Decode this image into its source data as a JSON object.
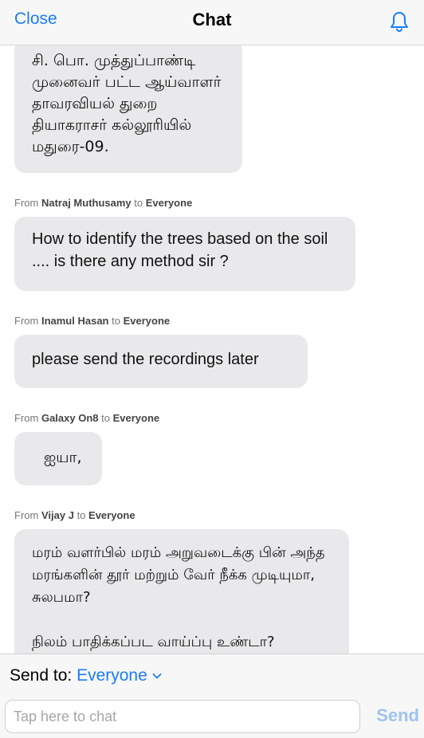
{
  "header": {
    "close_label": "Close",
    "title": "Chat",
    "bell_icon": "bell-icon"
  },
  "messages": [
    {
      "from": "",
      "to": "",
      "text": "சி. பொ. முத்துப்பாண்டி\nமுனைவர் பட்ட ஆய்வாளர்\nதாவரவியல் துறை\nதியாகராசர் கல்லூரியில்\nமதுரை-09."
    },
    {
      "from": "Natraj Muthusamy",
      "to": "Everyone",
      "text": "How to identify the trees based on the soil .... is there any method sir ?"
    },
    {
      "from": "Inamul Hasan",
      "to": "Everyone",
      "text": "please send the recordings later"
    },
    {
      "from": "Galaxy On8",
      "to": "Everyone",
      "text": "ஐயா,"
    },
    {
      "from": "Vijay J",
      "to": "Everyone",
      "text": "மரம் வளர்பில் மரம் அறுவடைக்கு பின் அந்த மரங்களின் தூர் மற்றும் வேர் நீக்க முடியுமா, சுலபமா?\n\nநிலம் பாதிக்கப்பட வாய்ப்பு உண்டா?"
    }
  ],
  "meta_labels": {
    "from": "From",
    "to": "to"
  },
  "composer": {
    "send_to_label": "Send to:",
    "recipient": "Everyone",
    "input_placeholder": "Tap here to chat",
    "input_value": "",
    "send_label": "Send"
  },
  "colors": {
    "accent": "#1a7cf5",
    "bubble": "#e9e9eb",
    "send_disabled": "#9fc3ef"
  }
}
